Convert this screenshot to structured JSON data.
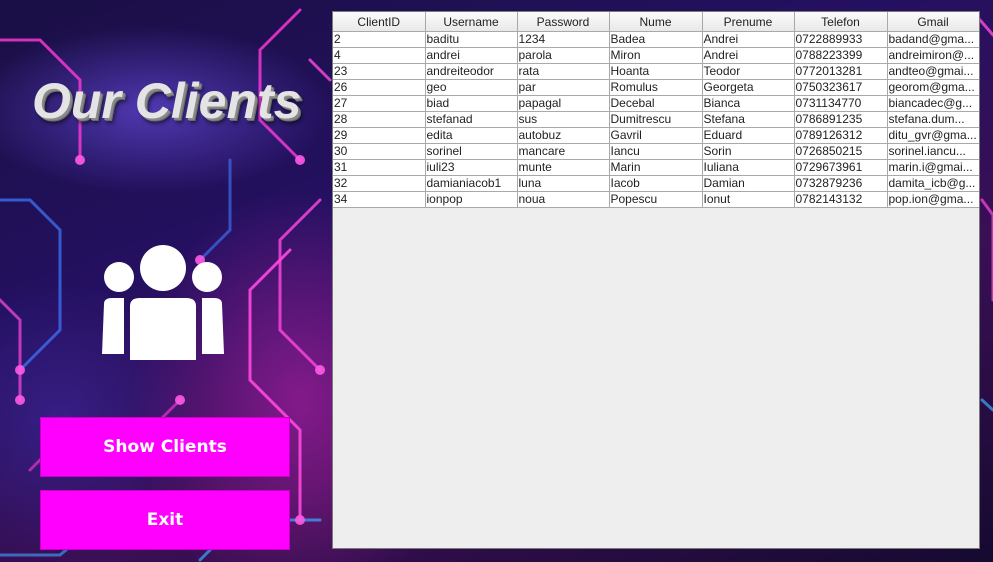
{
  "title": "Our Clients",
  "buttons": {
    "show_clients": "Show Clients",
    "exit": "Exit"
  },
  "colors": {
    "button_bg": "#ff00ff",
    "button_text": "#ffffff",
    "title_text": "#e4e4e4",
    "table_bg": "#eeeeee"
  },
  "icons": {
    "clients": "people-group-icon"
  },
  "table": {
    "columns": [
      "ClientID",
      "Username",
      "Password",
      "Nume",
      "Prenume",
      "Telefon",
      "Gmail"
    ],
    "rows": [
      [
        "2",
        "baditu",
        "1234",
        "Badea",
        "Andrei",
        "0722889933",
        "badand@gma..."
      ],
      [
        "4",
        "andrei",
        "parola",
        "Miron",
        "Andrei",
        "0788223399",
        "andreimiron@..."
      ],
      [
        "23",
        "andreiteodor",
        "rata",
        "Hoanta",
        "Teodor",
        "0772013281",
        "andteo@gmai..."
      ],
      [
        "26",
        "geo",
        "par",
        "Romulus",
        "Georgeta",
        "0750323617",
        "georom@gma..."
      ],
      [
        "27",
        "biad",
        "papagal",
        "Decebal",
        "Bianca",
        "0731134770",
        "biancadec@g..."
      ],
      [
        "28",
        "stefanad",
        "sus",
        "Dumitrescu",
        "Stefana",
        "0786891235",
        "stefana.dum..."
      ],
      [
        "29",
        "edita",
        "autobuz",
        "Gavril",
        "Eduard",
        "0789126312",
        "ditu_gvr@gma..."
      ],
      [
        "30",
        "sorinel",
        "mancare",
        "Iancu",
        "Sorin",
        "0726850215",
        "sorinel.iancu..."
      ],
      [
        "31",
        "iuli23",
        "munte",
        "Marin",
        "Iuliana",
        "0729673961",
        "marin.i@gmai..."
      ],
      [
        "32",
        "damianiacob1",
        "luna",
        "Iacob",
        "Damian",
        "0732879236",
        "damita_icb@g..."
      ],
      [
        "34",
        "ionpop",
        "noua",
        "Popescu",
        "Ionut",
        "0782143132",
        "pop.ion@gma..."
      ]
    ]
  }
}
